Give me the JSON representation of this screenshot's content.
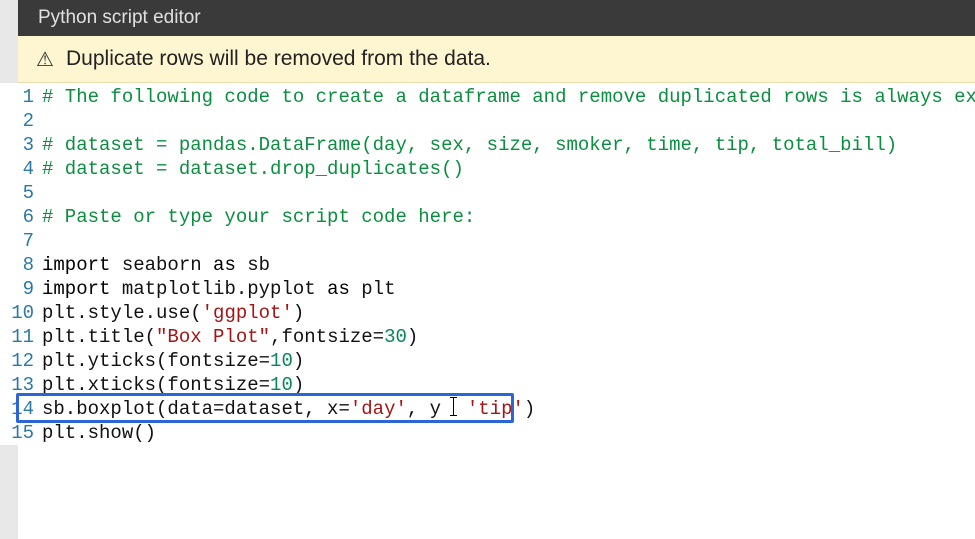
{
  "header": {
    "title": "Python script editor"
  },
  "warning": {
    "text": "Duplicate rows will be removed from the data."
  },
  "colors": {
    "header_bg": "#3a3a3a",
    "warning_bg": "#fdf6d0",
    "comment": "#0a8f3f",
    "string": "#a31515",
    "number": "#098658",
    "lineno": "#2a7aa8",
    "highlight_border": "#2a66d8"
  },
  "highlighted_line": 14,
  "lines": [
    {
      "n": "1",
      "tokens": [
        {
          "t": "# The following code to create a dataframe and remove duplicated rows is always executed ",
          "c": "comment"
        }
      ]
    },
    {
      "n": "2",
      "tokens": []
    },
    {
      "n": "3",
      "tokens": [
        {
          "t": "# dataset = pandas.DataFrame(day, sex, size, smoker, time, tip, total_bill)",
          "c": "comment"
        }
      ]
    },
    {
      "n": "4",
      "tokens": [
        {
          "t": "# dataset = dataset.drop_duplicates()",
          "c": "comment"
        }
      ]
    },
    {
      "n": "5",
      "tokens": []
    },
    {
      "n": "6",
      "tokens": [
        {
          "t": "# Paste or type your script code here:",
          "c": "comment"
        }
      ]
    },
    {
      "n": "7",
      "tokens": []
    },
    {
      "n": "8",
      "tokens": [
        {
          "t": "import",
          "c": "keyword"
        },
        {
          "t": " seaborn ",
          "c": "ident"
        },
        {
          "t": "as",
          "c": "keyword"
        },
        {
          "t": " sb",
          "c": "ident"
        }
      ]
    },
    {
      "n": "9",
      "tokens": [
        {
          "t": "import",
          "c": "keyword"
        },
        {
          "t": " matplotlib.pyplot ",
          "c": "ident"
        },
        {
          "t": "as",
          "c": "keyword"
        },
        {
          "t": " plt",
          "c": "ident"
        }
      ]
    },
    {
      "n": "10",
      "tokens": [
        {
          "t": "plt.style.use(",
          "c": "ident"
        },
        {
          "t": "'ggplot'",
          "c": "string"
        },
        {
          "t": ")",
          "c": "ident"
        }
      ]
    },
    {
      "n": "11",
      "tokens": [
        {
          "t": "plt.title(",
          "c": "ident"
        },
        {
          "t": "\"Box Plot\"",
          "c": "string"
        },
        {
          "t": ",fontsize=",
          "c": "ident"
        },
        {
          "t": "30",
          "c": "number"
        },
        {
          "t": ")",
          "c": "ident"
        }
      ]
    },
    {
      "n": "12",
      "tokens": [
        {
          "t": "plt.yticks(fontsize=",
          "c": "ident"
        },
        {
          "t": "10",
          "c": "number"
        },
        {
          "t": ")",
          "c": "ident"
        }
      ]
    },
    {
      "n": "13",
      "tokens": [
        {
          "t": "plt.xticks(fontsize=",
          "c": "ident"
        },
        {
          "t": "10",
          "c": "number"
        },
        {
          "t": ")",
          "c": "ident"
        }
      ]
    },
    {
      "n": "14",
      "tokens": [
        {
          "t": "sb.boxplot(data=dataset, x=",
          "c": "ident"
        },
        {
          "t": "'day'",
          "c": "string"
        },
        {
          "t": ", y ",
          "c": "ident"
        },
        {
          "t": "CURSOR",
          "c": "cursor"
        },
        {
          "t": " ",
          "c": "ident"
        },
        {
          "t": "'tip'",
          "c": "string"
        },
        {
          "t": ")",
          "c": "ident"
        }
      ]
    },
    {
      "n": "15",
      "tokens": [
        {
          "t": "plt.show()",
          "c": "ident"
        }
      ]
    }
  ]
}
